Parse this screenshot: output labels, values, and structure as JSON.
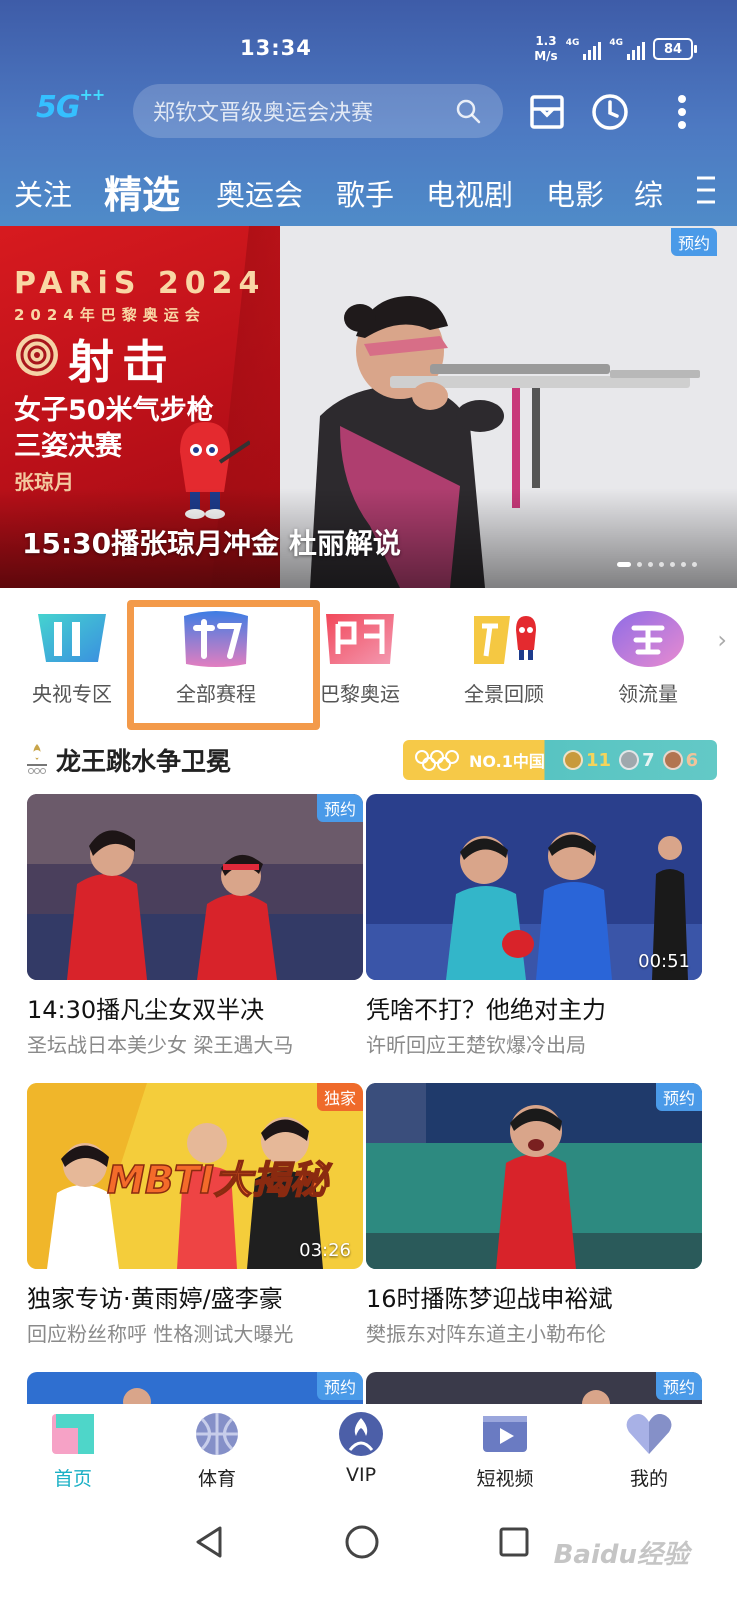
{
  "status_bar": {
    "time": "13:34",
    "net_speed_value": "1.3",
    "net_speed_unit": "M/s",
    "signal1_tag": "4G",
    "signal2_tag": "4G",
    "battery": "84"
  },
  "header": {
    "logo": "5G",
    "logo_plus": "++",
    "search_placeholder": "郑钦文晋级奥运会决赛",
    "icons": [
      "mailbox-icon",
      "history-clock-icon",
      "more-vertical-icon"
    ],
    "bg_color": "#4a6fb8"
  },
  "tabs": [
    {
      "label": "关注",
      "active": false
    },
    {
      "label": "精选",
      "active": true
    },
    {
      "label": "奥运会",
      "active": false
    },
    {
      "label": "歌手",
      "active": false
    },
    {
      "label": "电视剧",
      "active": false
    },
    {
      "label": "电影",
      "active": false
    },
    {
      "label": "综",
      "active": false
    }
  ],
  "banner": {
    "badge": "预约",
    "paris_title": "PARiS 2024",
    "paris_sub": "2024年巴黎奥运会",
    "sport": "射击",
    "event_line1": "女子50米气步枪",
    "event_line2": "三姿决赛",
    "athlete": "张琼月",
    "caption": "15:30播张琼月冲金 杜丽解说",
    "slide_count": 7,
    "active_slide": 1
  },
  "quick_entries": [
    {
      "label": "央视专区",
      "icon": "cctv-zone-icon"
    },
    {
      "label": "全部赛程",
      "icon": "schedule-icon"
    },
    {
      "label": "巴黎奥运",
      "icon": "paris-olympics-icon"
    },
    {
      "label": "全景回顾",
      "icon": "panorama-review-icon"
    },
    {
      "label": "领流量",
      "icon": "claim-data-icon"
    }
  ],
  "section": {
    "title": "龙王跳水争卫冕",
    "medal_rank": "NO.1中国",
    "gold": "11",
    "silver": "7",
    "bronze": "6"
  },
  "cards": [
    {
      "title": "14:30播凡尘女双半决",
      "subtitle": "圣坛战日本美少女 梁王遇大马",
      "badge": "预约",
      "duration": ""
    },
    {
      "title": "凭啥不打？他绝对主力",
      "subtitle": "许昕回应王楚钦爆冷出局",
      "badge": "",
      "duration": "00:51"
    },
    {
      "title": "独家专访·黄雨婷/盛李豪",
      "subtitle": "回应粉丝称呼 性格测试大曝光",
      "badge": "独家",
      "duration": "03:26",
      "overlay_text": "MBTI大揭秘"
    },
    {
      "title": "16时播陈梦迎战申裕斌",
      "subtitle": "樊振东对阵东道主小勒布伦",
      "badge": "预约",
      "duration": ""
    },
    {
      "badge": "预约"
    },
    {
      "badge": "预约"
    }
  ],
  "bottom_nav": [
    {
      "label": "首页",
      "active": true,
      "icon": "home-icon"
    },
    {
      "label": "体育",
      "active": false,
      "icon": "sports-icon"
    },
    {
      "label": "VIP",
      "active": false,
      "icon": "vip-icon"
    },
    {
      "label": "短视频",
      "active": false,
      "icon": "short-video-icon"
    },
    {
      "label": "我的",
      "active": false,
      "icon": "profile-heart-icon"
    }
  ],
  "system_nav": [
    "back-icon",
    "home-circle-icon",
    "recents-icon"
  ],
  "watermark": "Baidu经验",
  "colors": {
    "accent": "#1ab0c5",
    "badge_blue": "#4a9ae8",
    "badge_orange": "#ef6a2a",
    "highlight": "#f39a4a"
  }
}
